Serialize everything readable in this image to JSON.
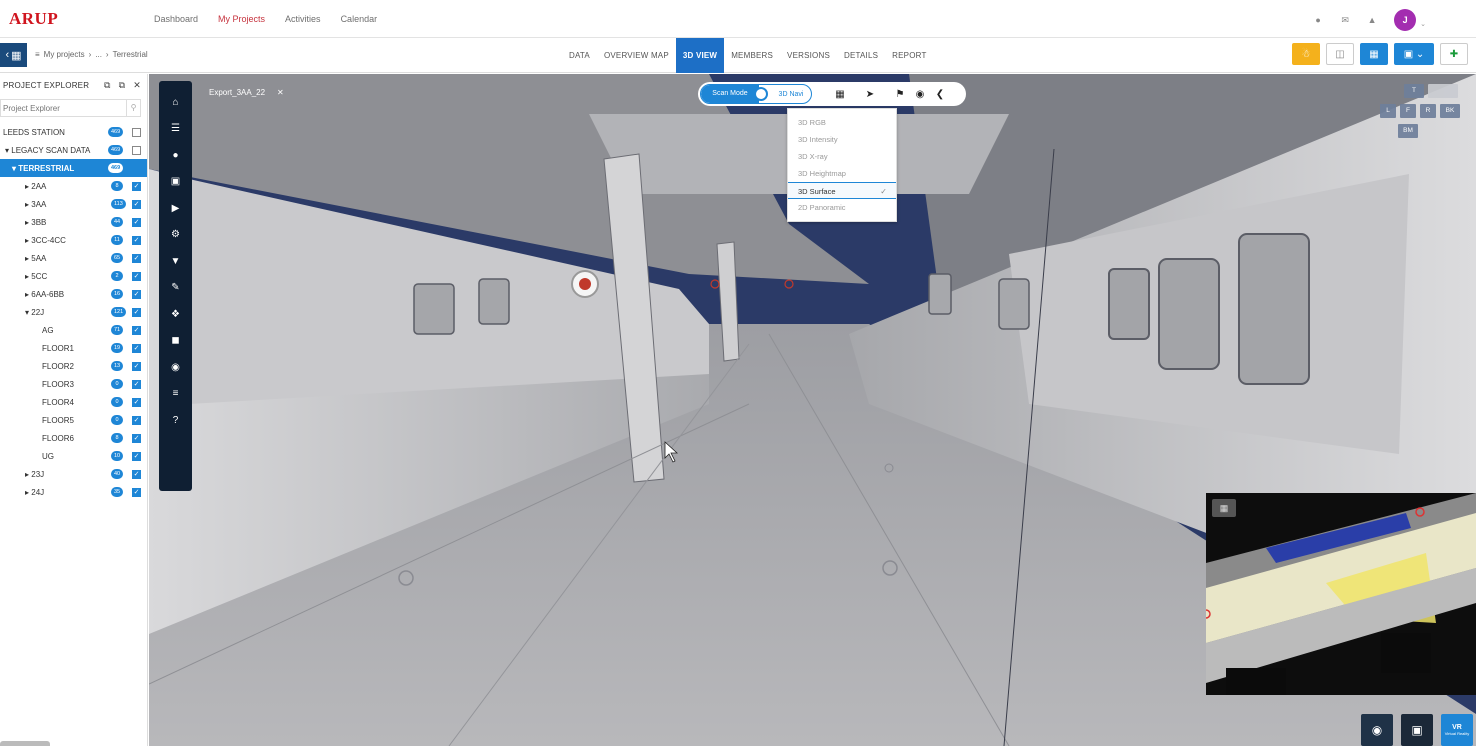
{
  "logo": "ARUP",
  "nav": {
    "items": [
      "Dashboard",
      "My Projects",
      "Activities",
      "Calendar"
    ],
    "active": "My Projects"
  },
  "user": {
    "initial": "J"
  },
  "breadcrumb": {
    "root": "My projects",
    "ellipsis": "...",
    "current": "Terrestrial"
  },
  "tabs": [
    "DATA",
    "OVERVIEW MAP",
    "3D VIEW",
    "MEMBERS",
    "VERSIONS",
    "DETAILS",
    "REPORT"
  ],
  "active_tab": "3D VIEW",
  "sidebar": {
    "title": "PROJECT EXPLORER",
    "search_placeholder": "Project Explorer",
    "tree": [
      {
        "label": "LEEDS STATION",
        "badge": "469",
        "indent": 0,
        "caret": "",
        "checked": false,
        "selected": false
      },
      {
        "label": "LEGACY SCAN DATA",
        "badge": "469",
        "indent": 1,
        "caret": "▾",
        "checked": false,
        "selected": false
      },
      {
        "label": "TERRESTRIAL",
        "badge": "469",
        "indent": 2,
        "caret": "▾",
        "checked": false,
        "selected": true
      },
      {
        "label": "2AA",
        "badge": "8",
        "indent": 3,
        "caret": "▸",
        "checked": true,
        "selected": false
      },
      {
        "label": "3AA",
        "badge": "113",
        "indent": 3,
        "caret": "▸",
        "checked": true,
        "selected": false
      },
      {
        "label": "3BB",
        "badge": "44",
        "indent": 3,
        "caret": "▸",
        "checked": true,
        "selected": false
      },
      {
        "label": "3CC-4CC",
        "badge": "11",
        "indent": 3,
        "caret": "▸",
        "checked": true,
        "selected": false
      },
      {
        "label": "5AA",
        "badge": "65",
        "indent": 3,
        "caret": "▸",
        "checked": true,
        "selected": false
      },
      {
        "label": "5CC",
        "badge": "2",
        "indent": 3,
        "caret": "▸",
        "checked": true,
        "selected": false
      },
      {
        "label": "6AA-6BB",
        "badge": "16",
        "indent": 3,
        "caret": "▸",
        "checked": true,
        "selected": false
      },
      {
        "label": "22J",
        "badge": "121",
        "indent": 3,
        "caret": "▾",
        "checked": true,
        "selected": false
      },
      {
        "label": "AG",
        "badge": "71",
        "indent": 4,
        "caret": "",
        "checked": true,
        "selected": false
      },
      {
        "label": "FLOOR1",
        "badge": "19",
        "indent": 4,
        "caret": "",
        "checked": true,
        "selected": false
      },
      {
        "label": "FLOOR2",
        "badge": "13",
        "indent": 4,
        "caret": "",
        "checked": true,
        "selected": false
      },
      {
        "label": "FLOOR3",
        "badge": "0",
        "indent": 4,
        "caret": "",
        "checked": true,
        "selected": false
      },
      {
        "label": "FLOOR4",
        "badge": "0",
        "indent": 4,
        "caret": "",
        "checked": true,
        "selected": false
      },
      {
        "label": "FLOOR5",
        "badge": "0",
        "indent": 4,
        "caret": "",
        "checked": true,
        "selected": false
      },
      {
        "label": "FLOOR6",
        "badge": "8",
        "indent": 4,
        "caret": "",
        "checked": true,
        "selected": false
      },
      {
        "label": "UG",
        "badge": "10",
        "indent": 4,
        "caret": "",
        "checked": true,
        "selected": false
      },
      {
        "label": "23J",
        "badge": "40",
        "indent": 3,
        "caret": "▸",
        "checked": true,
        "selected": false
      },
      {
        "label": "24J",
        "badge": "35",
        "indent": 3,
        "caret": "▸",
        "checked": true,
        "selected": false
      }
    ]
  },
  "viewer": {
    "file_tab": "Export_3AA_22",
    "mode_on": "Scan Mode",
    "mode_off": "3D Navi",
    "view_options": [
      "3D RGB",
      "3D Intensity",
      "3D X-ray",
      "3D Heightmap",
      "3D Surface",
      "2D Panoramic"
    ],
    "selected_view": "3D Surface",
    "cube_labels": {
      "top": "T",
      "left": "L",
      "front": "F",
      "right": "R",
      "back": "BK",
      "bottom": "BM"
    },
    "vr_label_1": "VR",
    "vr_label_2": "Virtual Reality"
  },
  "colors": {
    "accent": "#1e86d6",
    "brand": "#d0141e",
    "dock": "#0f1f33",
    "sky": "#2b3a67"
  }
}
